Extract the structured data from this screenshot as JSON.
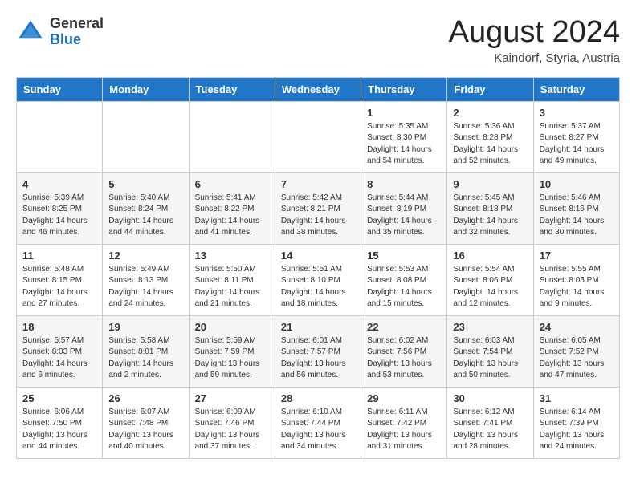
{
  "header": {
    "logo_general": "General",
    "logo_blue": "Blue",
    "month_year": "August 2024",
    "location": "Kaindorf, Styria, Austria"
  },
  "days_of_week": [
    "Sunday",
    "Monday",
    "Tuesday",
    "Wednesday",
    "Thursday",
    "Friday",
    "Saturday"
  ],
  "weeks": [
    [
      {
        "day": "",
        "info": ""
      },
      {
        "day": "",
        "info": ""
      },
      {
        "day": "",
        "info": ""
      },
      {
        "day": "",
        "info": ""
      },
      {
        "day": "1",
        "info": "Sunrise: 5:35 AM\nSunset: 8:30 PM\nDaylight: 14 hours\nand 54 minutes."
      },
      {
        "day": "2",
        "info": "Sunrise: 5:36 AM\nSunset: 8:28 PM\nDaylight: 14 hours\nand 52 minutes."
      },
      {
        "day": "3",
        "info": "Sunrise: 5:37 AM\nSunset: 8:27 PM\nDaylight: 14 hours\nand 49 minutes."
      }
    ],
    [
      {
        "day": "4",
        "info": "Sunrise: 5:39 AM\nSunset: 8:25 PM\nDaylight: 14 hours\nand 46 minutes."
      },
      {
        "day": "5",
        "info": "Sunrise: 5:40 AM\nSunset: 8:24 PM\nDaylight: 14 hours\nand 44 minutes."
      },
      {
        "day": "6",
        "info": "Sunrise: 5:41 AM\nSunset: 8:22 PM\nDaylight: 14 hours\nand 41 minutes."
      },
      {
        "day": "7",
        "info": "Sunrise: 5:42 AM\nSunset: 8:21 PM\nDaylight: 14 hours\nand 38 minutes."
      },
      {
        "day": "8",
        "info": "Sunrise: 5:44 AM\nSunset: 8:19 PM\nDaylight: 14 hours\nand 35 minutes."
      },
      {
        "day": "9",
        "info": "Sunrise: 5:45 AM\nSunset: 8:18 PM\nDaylight: 14 hours\nand 32 minutes."
      },
      {
        "day": "10",
        "info": "Sunrise: 5:46 AM\nSunset: 8:16 PM\nDaylight: 14 hours\nand 30 minutes."
      }
    ],
    [
      {
        "day": "11",
        "info": "Sunrise: 5:48 AM\nSunset: 8:15 PM\nDaylight: 14 hours\nand 27 minutes."
      },
      {
        "day": "12",
        "info": "Sunrise: 5:49 AM\nSunset: 8:13 PM\nDaylight: 14 hours\nand 24 minutes."
      },
      {
        "day": "13",
        "info": "Sunrise: 5:50 AM\nSunset: 8:11 PM\nDaylight: 14 hours\nand 21 minutes."
      },
      {
        "day": "14",
        "info": "Sunrise: 5:51 AM\nSunset: 8:10 PM\nDaylight: 14 hours\nand 18 minutes."
      },
      {
        "day": "15",
        "info": "Sunrise: 5:53 AM\nSunset: 8:08 PM\nDaylight: 14 hours\nand 15 minutes."
      },
      {
        "day": "16",
        "info": "Sunrise: 5:54 AM\nSunset: 8:06 PM\nDaylight: 14 hours\nand 12 minutes."
      },
      {
        "day": "17",
        "info": "Sunrise: 5:55 AM\nSunset: 8:05 PM\nDaylight: 14 hours\nand 9 minutes."
      }
    ],
    [
      {
        "day": "18",
        "info": "Sunrise: 5:57 AM\nSunset: 8:03 PM\nDaylight: 14 hours\nand 6 minutes."
      },
      {
        "day": "19",
        "info": "Sunrise: 5:58 AM\nSunset: 8:01 PM\nDaylight: 14 hours\nand 2 minutes."
      },
      {
        "day": "20",
        "info": "Sunrise: 5:59 AM\nSunset: 7:59 PM\nDaylight: 13 hours\nand 59 minutes."
      },
      {
        "day": "21",
        "info": "Sunrise: 6:01 AM\nSunset: 7:57 PM\nDaylight: 13 hours\nand 56 minutes."
      },
      {
        "day": "22",
        "info": "Sunrise: 6:02 AM\nSunset: 7:56 PM\nDaylight: 13 hours\nand 53 minutes."
      },
      {
        "day": "23",
        "info": "Sunrise: 6:03 AM\nSunset: 7:54 PM\nDaylight: 13 hours\nand 50 minutes."
      },
      {
        "day": "24",
        "info": "Sunrise: 6:05 AM\nSunset: 7:52 PM\nDaylight: 13 hours\nand 47 minutes."
      }
    ],
    [
      {
        "day": "25",
        "info": "Sunrise: 6:06 AM\nSunset: 7:50 PM\nDaylight: 13 hours\nand 44 minutes."
      },
      {
        "day": "26",
        "info": "Sunrise: 6:07 AM\nSunset: 7:48 PM\nDaylight: 13 hours\nand 40 minutes."
      },
      {
        "day": "27",
        "info": "Sunrise: 6:09 AM\nSunset: 7:46 PM\nDaylight: 13 hours\nand 37 minutes."
      },
      {
        "day": "28",
        "info": "Sunrise: 6:10 AM\nSunset: 7:44 PM\nDaylight: 13 hours\nand 34 minutes."
      },
      {
        "day": "29",
        "info": "Sunrise: 6:11 AM\nSunset: 7:42 PM\nDaylight: 13 hours\nand 31 minutes."
      },
      {
        "day": "30",
        "info": "Sunrise: 6:12 AM\nSunset: 7:41 PM\nDaylight: 13 hours\nand 28 minutes."
      },
      {
        "day": "31",
        "info": "Sunrise: 6:14 AM\nSunset: 7:39 PM\nDaylight: 13 hours\nand 24 minutes."
      }
    ]
  ]
}
